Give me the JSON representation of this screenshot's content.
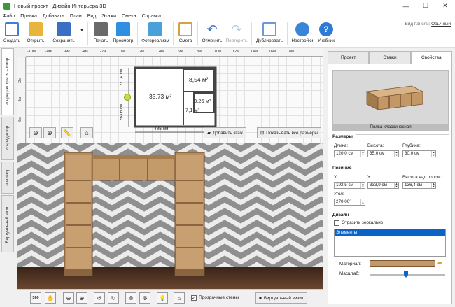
{
  "window": {
    "title": "Новый проект - Дизайн Интерьера 3D",
    "controls": {
      "minimize": "—",
      "maximize": "☐",
      "close": "✕"
    }
  },
  "menu": [
    "Файл",
    "Правка",
    "Добавить",
    "План",
    "Вид",
    "Этажи",
    "Смета",
    "Справка"
  ],
  "toolbar": {
    "buttons": [
      {
        "label": "Создать",
        "icon": "new-document-icon",
        "color": "#3f7fd6"
      },
      {
        "label": "Открыть",
        "icon": "open-folder-icon",
        "color": "#e9b43c"
      },
      {
        "label": "Сохранить",
        "icon": "save-disk-icon",
        "color": "#3a6fc4"
      },
      {
        "label": "Печать",
        "icon": "printer-icon",
        "color": "#5a5a5a"
      },
      {
        "label": "Просмотр",
        "icon": "monitor-icon",
        "color": "#2f8fe0"
      },
      {
        "label": "Фотореализм",
        "icon": "photo-icon",
        "color": "#4aa0d8"
      },
      {
        "label": "Смета",
        "icon": "estimate-icon",
        "color": "#d8a040"
      },
      {
        "label": "Отменить",
        "icon": "undo-icon",
        "color": "#3a78c8"
      },
      {
        "label": "Повторить",
        "icon": "redo-icon",
        "color": "#b8c8dc"
      },
      {
        "label": "Дублировать",
        "icon": "duplicate-icon",
        "color": "#6a9ad8"
      },
      {
        "label": "Настройки",
        "icon": "settings-gear-icon",
        "color": "#3a86d6"
      },
      {
        "label": "Учебник",
        "icon": "help-icon",
        "color": "#2f7ad6"
      }
    ],
    "panel_view_label": "Вид панели:",
    "panel_view_value": "Обычный"
  },
  "left_tabs": [
    "2D-редактор и 3D-обзор",
    "2D-редактор",
    "3D-обзор",
    "Виртуальный визит"
  ],
  "plan": {
    "ruler_top": [
      "-10м",
      "-8м",
      "-6м",
      "-4м",
      "-2м",
      "0м",
      "2м",
      "4м",
      "6м",
      "8м",
      "10м",
      "12м",
      "14м",
      "16м",
      "18м"
    ],
    "ruler_left": [
      "2м",
      "4м",
      "6м"
    ],
    "rooms": [
      {
        "label": "33,73 м²"
      },
      {
        "label": "8,54 м²"
      },
      {
        "label": "3,26 м²"
      },
      {
        "label": "7,1 м²"
      }
    ],
    "dim_bottom": "485 см",
    "dim_left_top": "271,4 см",
    "dim_left_bottom": "263,6 см",
    "add_floor_label": "Добавить этаж",
    "show_sizes_label": "Показывать все размеры"
  },
  "bottom": {
    "transparent_walls_label": "Прозрачные стены",
    "virtual_visit_label": "Виртуальный визит",
    "view_360_label": "360"
  },
  "right_panel": {
    "tabs": [
      "Проект",
      "Этажи",
      "Свойства"
    ],
    "active_tab": "Свойства",
    "preview_label": "Полка классическая",
    "sizes": {
      "title": "Размеры",
      "length_label": "Длина:",
      "length_value": "120,0 см",
      "height_label": "Высота:",
      "height_value": "35,0 см",
      "depth_label": "Глубина:",
      "depth_value": "30,0 см"
    },
    "position": {
      "title": "Позиция",
      "x_label": "X:",
      "x_value": "192,5 см",
      "y_label": "Y:",
      "y_value": "333,9 см",
      "floor_height_label": "Высота над полом:",
      "floor_height_value": "136,4 см",
      "angle_label": "Угол:",
      "angle_value": "270,00°"
    },
    "design": {
      "title": "Дизайн",
      "mirror_label": "Отразить зеркально",
      "list_items": [
        "Элементы"
      ],
      "material_label": "Материал:",
      "scale_label": "Масштаб:"
    }
  },
  "colors": {
    "accent": "#0a64c8",
    "wood": "#c09a68",
    "floor": "#5a3a26",
    "wall_pattern": "#8f8f8f"
  }
}
